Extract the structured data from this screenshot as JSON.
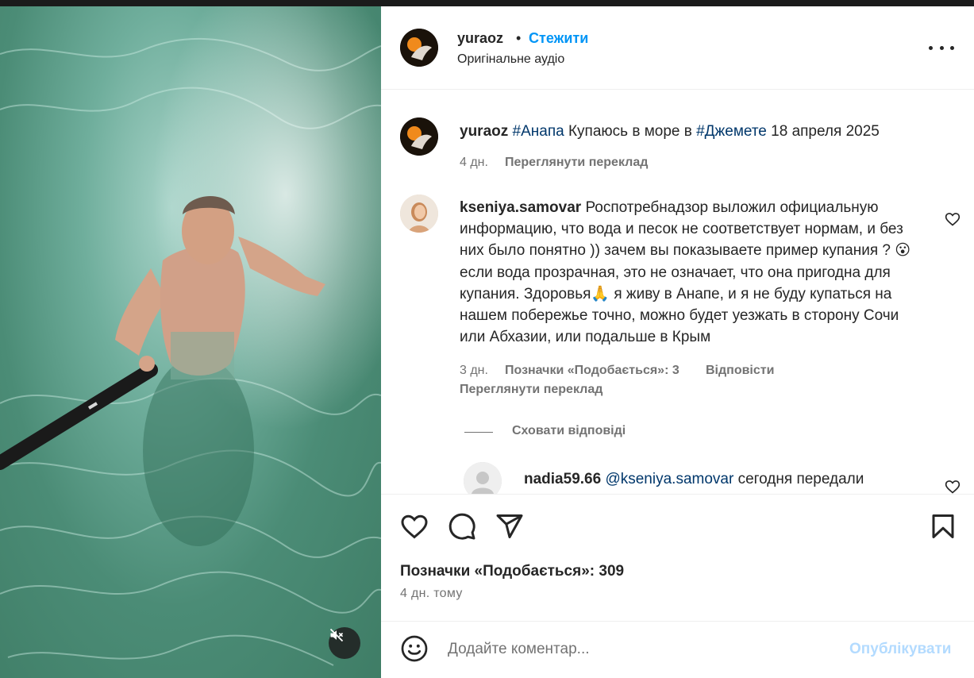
{
  "post": {
    "username": "yuraoz",
    "follow_label": "Стежити",
    "separator": "•",
    "audio_label": "Оригінальне аудіо",
    "caption": {
      "username": "yuraoz",
      "tag1": "#Анапа",
      "text1": " Купаюсь в море в ",
      "tag2": "#Джемете",
      "text2": " 18 апреля 2025",
      "time": "4 дн.",
      "translate": "Переглянути переклад"
    },
    "comments": [
      {
        "username": "kseniya.samovar",
        "text": " Роспотребнадзор выложил официальную информацию, что вода и песок не соответствует нормам, и без них было понятно )) зачем вы показываете пример купания ? 😮 если вода прозрачная, это не означает, что она пригодна для купания. Здоровья🙏 я живу в Анапе, и я не буду купаться на нашем побережье точно, можно будет уезжать в сторону Сочи или Абхазии, или подальше в Крым",
        "time": "3 дн.",
        "likes_label": "Позначки «Подобається»: 3",
        "reply_label": "Відповісти",
        "translate": "Переглянути переклад",
        "hide_replies": "Сховати відповіді"
      },
      {
        "username": "nadia59.66",
        "mention": "@kseniya.samovar",
        "text": " сегодня передали"
      }
    ],
    "likes_text": "Позначки «Подобається»: 309",
    "posted_ago": "4 дн. тому"
  },
  "composer": {
    "placeholder": "Додайте коментар...",
    "publish_label": "Опублікувати"
  },
  "icons": {
    "like": "heart-icon",
    "comment": "comment-icon",
    "share": "send-icon",
    "save": "bookmark-icon",
    "emoji": "emoji-icon",
    "mute": "speaker-muted-icon",
    "more": "more-icon"
  },
  "colors": {
    "link": "#0095f6",
    "hashtag": "#00376b",
    "secondary": "#737373",
    "publish_disabled": "#b3dbff"
  }
}
